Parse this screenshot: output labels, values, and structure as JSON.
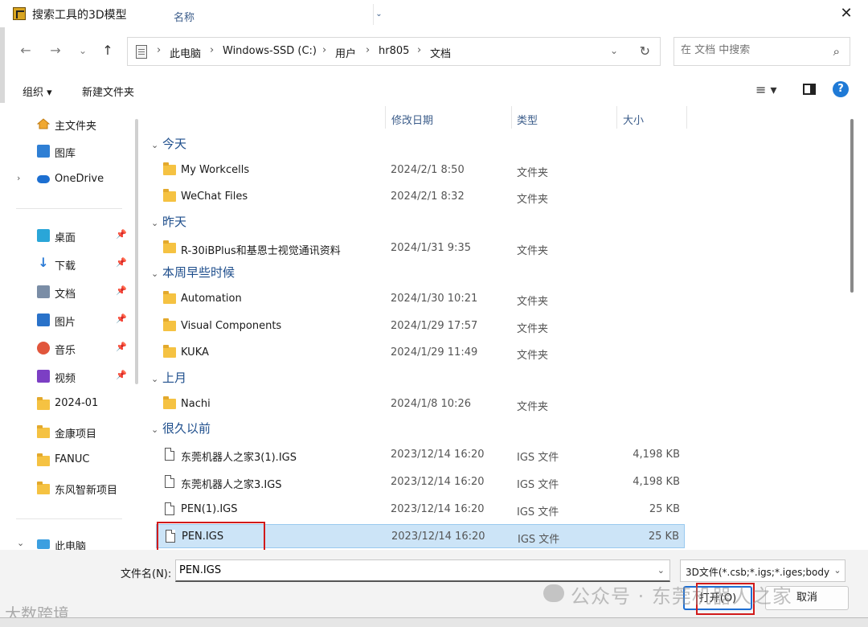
{
  "window": {
    "title": "搜索工具的3D模型",
    "close": "✕"
  },
  "nav": {
    "back": "←",
    "forward": "→",
    "recent": "⌄",
    "up": "↑"
  },
  "address": {
    "crumbs": [
      "此电脑",
      "Windows-SSD (C:)",
      "用户",
      "hr805",
      "文档"
    ],
    "separator": "›",
    "dropdown": "⌄",
    "refresh": "↻"
  },
  "search": {
    "placeholder": "在 文档 中搜索",
    "icon": "⌕"
  },
  "toolbar": {
    "organize": "组织 ▾",
    "new_folder": "新建文件夹",
    "view_menu": "≡ ▾",
    "help": "?"
  },
  "sidebar": {
    "pin": "📌",
    "expand": "›",
    "collapse": "⌄",
    "items": [
      {
        "label": "主文件夹",
        "icon": "home-icon"
      },
      {
        "label": "图库",
        "icon": "gallery-icon"
      },
      {
        "label": "OneDrive",
        "icon": "cloud-icon"
      },
      {
        "label": "桌面",
        "icon": "desktop-icon"
      },
      {
        "label": "下载",
        "icon": "download-icon"
      },
      {
        "label": "文档",
        "icon": "document-icon"
      },
      {
        "label": "图片",
        "icon": "pictures-icon"
      },
      {
        "label": "音乐",
        "icon": "music-icon"
      },
      {
        "label": "视频",
        "icon": "video-icon"
      },
      {
        "label": "2024-01",
        "icon": "folder-icon"
      },
      {
        "label": "金康项目",
        "icon": "folder-icon"
      },
      {
        "label": "FANUC",
        "icon": "folder-icon"
      },
      {
        "label": "东风智新项目",
        "icon": "folder-icon"
      },
      {
        "label": "此电脑",
        "icon": "pc-icon"
      }
    ]
  },
  "columns": {
    "name": "名称",
    "date": "修改日期",
    "type": "类型",
    "size": "大小",
    "sort_indicator": "⌄"
  },
  "groups": {
    "today": "今天",
    "yesterday": "昨天",
    "earlier_week": "本周早些时候",
    "last_month": "上月",
    "long_ago": "很久以前",
    "chevron": "⌄"
  },
  "files": [
    {
      "name": "My Workcells",
      "date": "2024/2/1 8:50",
      "type": "文件夹",
      "size": ""
    },
    {
      "name": "WeChat Files",
      "date": "2024/2/1 8:32",
      "type": "文件夹",
      "size": ""
    },
    {
      "name": "R-30iBPlus和基恩士视觉通讯资料",
      "date": "2024/1/31 9:35",
      "type": "文件夹",
      "size": ""
    },
    {
      "name": "Automation",
      "date": "2024/1/30 10:21",
      "type": "文件夹",
      "size": ""
    },
    {
      "name": "Visual Components",
      "date": "2024/1/29 17:57",
      "type": "文件夹",
      "size": ""
    },
    {
      "name": "KUKA",
      "date": "2024/1/29 11:49",
      "type": "文件夹",
      "size": ""
    },
    {
      "name": "Nachi",
      "date": "2024/1/8 10:26",
      "type": "文件夹",
      "size": ""
    },
    {
      "name": "东莞机器人之家3(1).IGS",
      "date": "2023/12/14 16:20",
      "type": "IGS 文件",
      "size": "4,198 KB"
    },
    {
      "name": "东莞机器人之家3.IGS",
      "date": "2023/12/14 16:20",
      "type": "IGS 文件",
      "size": "4,198 KB"
    },
    {
      "name": "PEN(1).IGS",
      "date": "2023/12/14 16:20",
      "type": "IGS 文件",
      "size": "25 KB"
    },
    {
      "name": "PEN.IGS",
      "date": "2023/12/14 16:20",
      "type": "IGS 文件",
      "size": "25 KB",
      "selected": true
    }
  ],
  "footer": {
    "filename_label": "文件名(N):",
    "filename_value": "PEN.IGS",
    "filename_drop": "⌄",
    "filter": "3D文件(*.csb;*.igs;*.iges;body",
    "filter_drop": "⌄",
    "open": "打开(O)",
    "cancel": "取消"
  },
  "watermark": {
    "text": "公众号 · 东莞机器人之家",
    "corner": "大数跨境"
  },
  "colors": {
    "selection": "#cce4f7",
    "group_header": "#1e4e8c",
    "highlight_box": "#d11a1a",
    "accent": "#1e6fd4"
  }
}
